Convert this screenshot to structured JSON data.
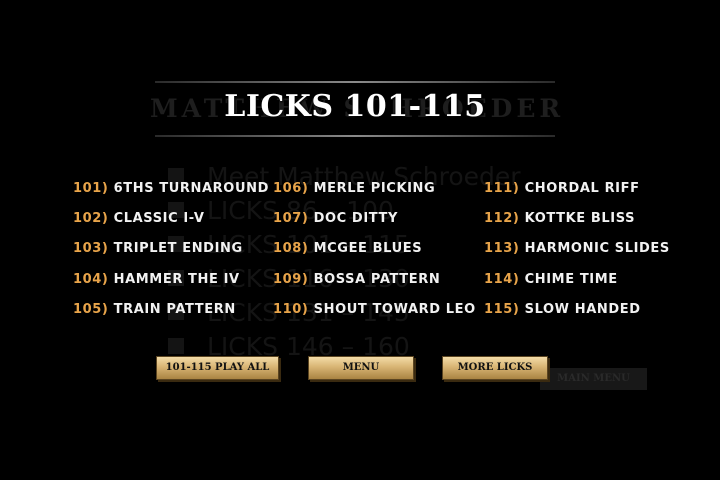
{
  "background": {
    "title": "MATTHEW SCHROEDER",
    "items": [
      "Meet Matthew Schroeder",
      "LICKS 86 – 100",
      "LICKS 101 – 115",
      "LICKS 116 – 130",
      "LICKS 131 – 145",
      "LICKS 146 – 160"
    ],
    "main_menu_label": "MAIN MENU"
  },
  "title": "LICKS 101-115",
  "columns": [
    [
      {
        "num": "101)",
        "name": "6THS TURNAROUND"
      },
      {
        "num": "102)",
        "name": "CLASSIC I-V"
      },
      {
        "num": "103)",
        "name": "TRIPLET ENDING"
      },
      {
        "num": "104)",
        "name": "HAMMER THE IV"
      },
      {
        "num": "105)",
        "name": "TRAIN PATTERN"
      }
    ],
    [
      {
        "num": "106)",
        "name": "MERLE PICKING"
      },
      {
        "num": "107)",
        "name": "DOC DITTY"
      },
      {
        "num": "108)",
        "name": "MCGEE BLUES"
      },
      {
        "num": "109)",
        "name": "BOSSA PATTERN"
      },
      {
        "num": "110)",
        "name": "SHOUT TOWARD LEO"
      }
    ],
    [
      {
        "num": "111)",
        "name": "CHORDAL RIFF"
      },
      {
        "num": "112)",
        "name": "KOTTKE BLISS"
      },
      {
        "num": "113)",
        "name": "HARMONIC SLIDES"
      },
      {
        "num": "114)",
        "name": "CHIME TIME"
      },
      {
        "num": "115)",
        "name": "SLOW HANDED"
      }
    ]
  ],
  "buttons": {
    "play_all": "101-115 PLAY ALL",
    "menu": "MENU",
    "more_licks": "MORE LICKS"
  },
  "colors": {
    "number": "#e8a44a",
    "text": "#f2f2f2",
    "button_gold": "#d8b574"
  }
}
